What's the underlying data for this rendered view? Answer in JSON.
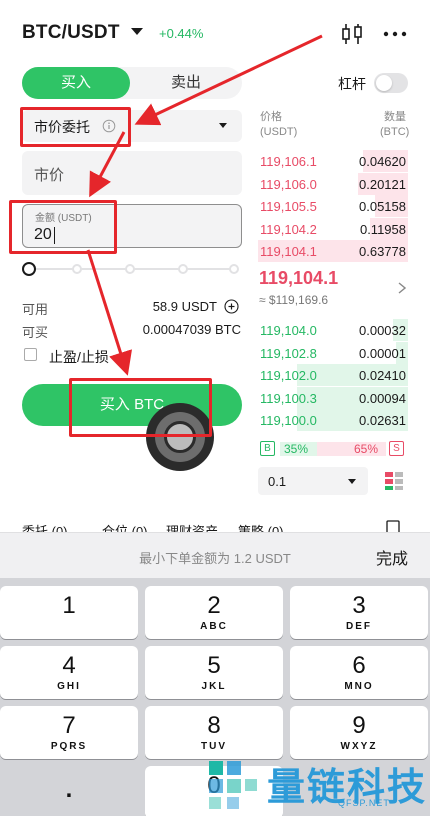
{
  "header": {
    "pair": "BTC/USDT",
    "change_pct": "+0.44%",
    "candle_icon": "candlestick-icon",
    "more_icon": "more-dots-icon"
  },
  "trade_panel": {
    "tabs": {
      "buy": "买入",
      "sell": "卖出",
      "active": "buy"
    },
    "leverage_label": "杠杆",
    "leverage_enabled": false,
    "order_type": "市价委托",
    "price_field": "市价",
    "amount": {
      "label": "金额 (USDT)",
      "value": "20"
    },
    "slider_percent": 0,
    "available": {
      "label": "可用",
      "value": "58.9 USDT"
    },
    "can_buy": {
      "label": "可买",
      "value": "0.00047039 BTC"
    },
    "tpsl_label": "止盈/止损",
    "tpsl_checked": false,
    "buy_button": "买入 BTC"
  },
  "order_book": {
    "price_header": [
      "价格",
      "(USDT)"
    ],
    "qty_header": [
      "数量",
      "(BTC)"
    ],
    "asks": [
      {
        "price": "119,106.1",
        "qty": "0.04620",
        "depth": 0.3
      },
      {
        "price": "119,106.0",
        "qty": "0.20121",
        "depth": 0.33
      },
      {
        "price": "119,105.5",
        "qty": "0.05158",
        "depth": 0.22
      },
      {
        "price": "119,104.2",
        "qty": "0.11958",
        "depth": 0.25
      },
      {
        "price": "119,104.1",
        "qty": "0.63778",
        "depth": 1.0
      }
    ],
    "mid_price": "119,104.1",
    "mid_usd": "≈ $119,169.6",
    "bids": [
      {
        "price": "119,104.0",
        "qty": "0.00032",
        "depth": 0.1
      },
      {
        "price": "119,102.8",
        "qty": "0.00001",
        "depth": 0.08
      },
      {
        "price": "119,102.0",
        "qty": "0.02410",
        "depth": 0.74
      },
      {
        "price": "119,100.3",
        "qty": "0.00094",
        "depth": 0.74
      },
      {
        "price": "119,100.0",
        "qty": "0.02631",
        "depth": 0.74
      }
    ],
    "ratio": {
      "buy_badge": "B",
      "buy_pct": "35%",
      "sell_pct": "65%",
      "sell_badge": "S",
      "buy_fraction": 0.35
    },
    "precision": "0.1"
  },
  "bottom_tabs": [
    "委托 (0)",
    "仓位 (0)",
    "理财资产",
    "策略 (0)"
  ],
  "keyboard": {
    "hint": "最小下单金额为 1.2 USDT",
    "done": "完成",
    "keys": [
      {
        "num": "1",
        "letters": ""
      },
      {
        "num": "2",
        "letters": "ABC"
      },
      {
        "num": "3",
        "letters": "DEF"
      },
      {
        "num": "4",
        "letters": "GHI"
      },
      {
        "num": "5",
        "letters": "JKL"
      },
      {
        "num": "6",
        "letters": "MNO"
      },
      {
        "num": "7",
        "letters": "PQRS"
      },
      {
        "num": "8",
        "letters": "TUV"
      },
      {
        "num": "9",
        "letters": "WXYZ"
      },
      {
        "num": ".",
        "letters": ""
      },
      {
        "num": "0",
        "letters": ""
      }
    ]
  },
  "watermark": {
    "text": "量链科技",
    "sub": "QFSP.NET"
  },
  "colors": {
    "buy_green": "#2fc466",
    "sell_red": "#e84b66",
    "annotation_red": "#e5262b",
    "watermark_blue": "#2d9bd8"
  }
}
